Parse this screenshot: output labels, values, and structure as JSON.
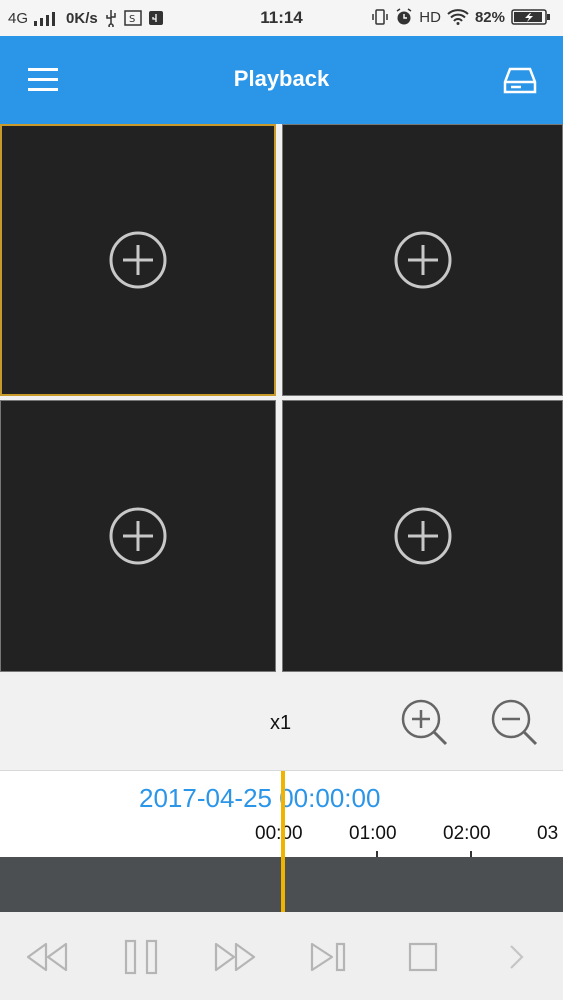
{
  "status": {
    "network": "4G",
    "speed": "0K/s",
    "time": "11:14",
    "hd": "HD",
    "battery": "82%"
  },
  "appbar": {
    "title": "Playback",
    "icons": [
      "menu-icon",
      "storage-icon"
    ]
  },
  "panes": [
    {
      "icon": "add-icon",
      "active": true
    },
    {
      "icon": "add-icon",
      "active": false
    },
    {
      "icon": "add-icon",
      "active": false
    },
    {
      "icon": "add-icon",
      "active": false
    }
  ],
  "zoom": {
    "speed": "x1",
    "icons": [
      "zoom-in-icon",
      "zoom-out-icon"
    ]
  },
  "timeline": {
    "datetime": "2017-04-25 00:00:00",
    "ticks": [
      "00:00",
      "01:00",
      "02:00",
      "03"
    ]
  },
  "controls": {
    "icons": [
      "rewind-icon",
      "pause-icon",
      "fast-forward-icon",
      "step-forward-icon",
      "stop-icon",
      "next-icon"
    ]
  },
  "colors": {
    "appbar": "#2b95e8",
    "selected_border": "#c89a2c",
    "cursor": "#f0b400",
    "date_text": "#2b95e8"
  }
}
